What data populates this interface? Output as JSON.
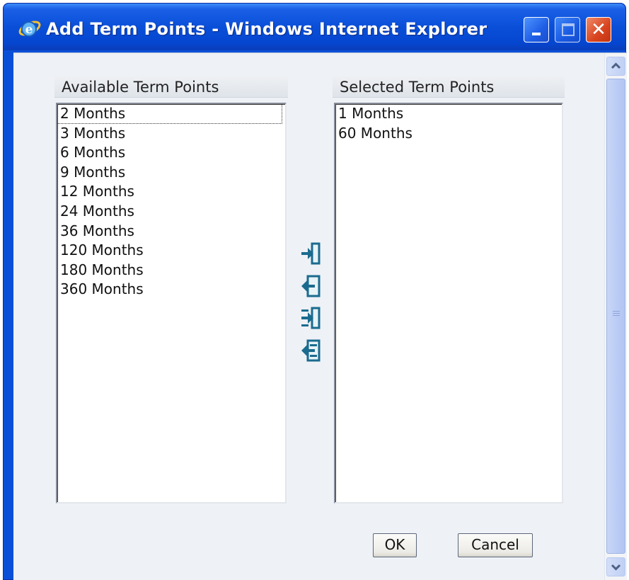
{
  "window": {
    "title": "Add Term Points - Windows Internet Explorer",
    "close_glyph": "✕"
  },
  "available": {
    "header": "Available Term Points",
    "items": [
      "2 Months",
      "3 Months",
      "6 Months",
      "9 Months",
      "12 Months",
      "24 Months",
      "36 Months",
      "120 Months",
      "180 Months",
      "360 Months"
    ]
  },
  "selected": {
    "header": "Selected Term Points",
    "items": [
      "1 Months",
      "60 Months"
    ]
  },
  "transfer_buttons": [
    {
      "name": "move-right-icon"
    },
    {
      "name": "move-left-icon"
    },
    {
      "name": "move-all-right-icon"
    },
    {
      "name": "move-all-left-icon"
    }
  ],
  "buttons": {
    "ok": "OK",
    "cancel": "Cancel"
  },
  "colors": {
    "titlebar": "#0a4fd8",
    "client_bg": "#eef1f6",
    "close_button": "#d8431e",
    "icon_teal": "#1b6b8f"
  }
}
